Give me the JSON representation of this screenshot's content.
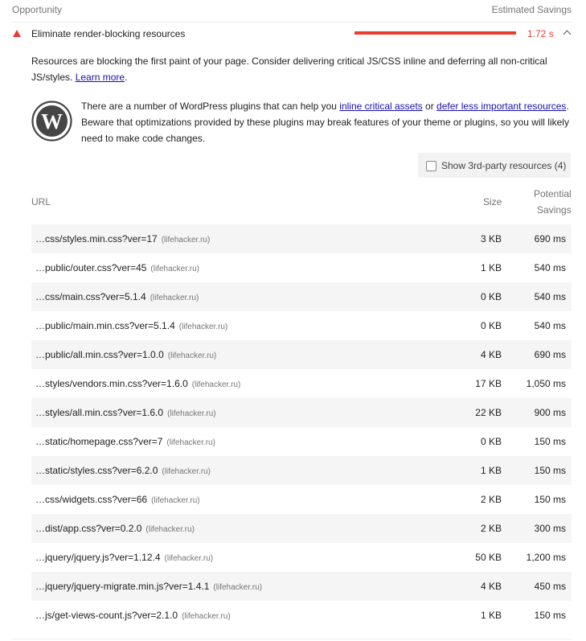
{
  "header": {
    "opportunity": "Opportunity",
    "estimated_savings": "Estimated Savings"
  },
  "audit": {
    "title": "Eliminate render-blocking resources",
    "savings": "1.72 s",
    "savings_fraction": 0.95,
    "status_color": "#eb3b2f",
    "description_prefix": "Resources are blocking the first paint of your page. Consider delivering critical JS/CSS inline and deferring all non-critical JS/styles.",
    "learn_more": "Learn more",
    "description_suffix": "."
  },
  "stack_pack": {
    "icon": "wordpress-icon",
    "text_1": "There are a number of WordPress plugins that can help you",
    "link_1": "inline critical assets",
    "text_2": "or",
    "link_2": "defer less important resources",
    "text_3": ". Beware that optimizations provided by these plugins may break features of your theme or plugins, so you will likely need to make code changes."
  },
  "third_party_toggle": {
    "label": "Show 3rd-party resources (4)",
    "checked": false
  },
  "table": {
    "headers": {
      "url": "URL",
      "size": "Size",
      "savings_line1": "Potential",
      "savings_line2": "Savings"
    },
    "rows": [
      {
        "url": "…css/styles.min.css?ver=17",
        "host": "(lifehacker.ru)",
        "size": "3 KB",
        "savings": "690 ms"
      },
      {
        "url": "…public/outer.css?ver=45",
        "host": "(lifehacker.ru)",
        "size": "1 KB",
        "savings": "540 ms"
      },
      {
        "url": "…css/main.css?ver=5.1.4",
        "host": "(lifehacker.ru)",
        "size": "0 KB",
        "savings": "540 ms"
      },
      {
        "url": "…public/main.min.css?ver=5.1.4",
        "host": "(lifehacker.ru)",
        "size": "0 KB",
        "savings": "540 ms"
      },
      {
        "url": "…public/all.min.css?ver=1.0.0",
        "host": "(lifehacker.ru)",
        "size": "4 KB",
        "savings": "690 ms"
      },
      {
        "url": "…styles/vendors.min.css?ver=1.6.0",
        "host": "(lifehacker.ru)",
        "size": "17 KB",
        "savings": "1,050 ms"
      },
      {
        "url": "…styles/all.min.css?ver=1.6.0",
        "host": "(lifehacker.ru)",
        "size": "22 KB",
        "savings": "900 ms"
      },
      {
        "url": "…static/homepage.css?ver=7",
        "host": "(lifehacker.ru)",
        "size": "0 KB",
        "savings": "150 ms"
      },
      {
        "url": "…static/styles.css?ver=6.2.0",
        "host": "(lifehacker.ru)",
        "size": "1 KB",
        "savings": "150 ms"
      },
      {
        "url": "…css/widgets.css?ver=66",
        "host": "(lifehacker.ru)",
        "size": "2 KB",
        "savings": "150 ms"
      },
      {
        "url": "…dist/app.css?ver=0.2.0",
        "host": "(lifehacker.ru)",
        "size": "2 KB",
        "savings": "300 ms"
      },
      {
        "url": "…jquery/jquery.js?ver=1.12.4",
        "host": "(lifehacker.ru)",
        "size": "50 KB",
        "savings": "1,200 ms"
      },
      {
        "url": "…jquery/jquery-migrate.min.js?ver=1.4.1",
        "host": "(lifehacker.ru)",
        "size": "4 KB",
        "savings": "450 ms"
      },
      {
        "url": "…js/get-views-count.js?ver=2.1.0",
        "host": "(lifehacker.ru)",
        "size": "1 KB",
        "savings": "150 ms"
      }
    ]
  }
}
